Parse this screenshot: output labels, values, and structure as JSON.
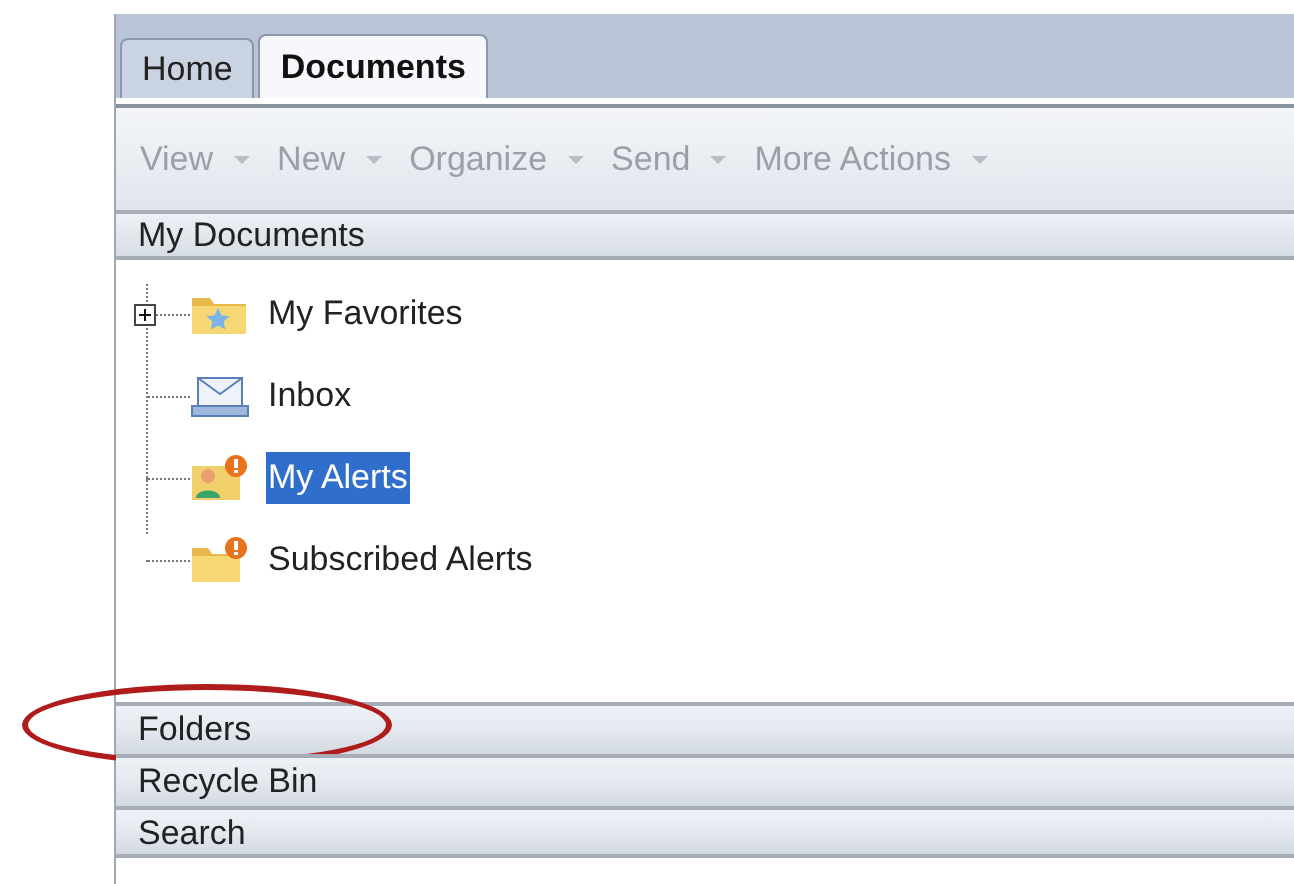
{
  "tabs": [
    {
      "label": "Home",
      "selected": false
    },
    {
      "label": "Documents",
      "selected": true
    }
  ],
  "toolbar": [
    {
      "label": "View"
    },
    {
      "label": "New"
    },
    {
      "label": "Organize"
    },
    {
      "label": "Send"
    },
    {
      "label": "More Actions"
    }
  ],
  "panel": {
    "title": "My Documents"
  },
  "tree": [
    {
      "label": "My Favorites",
      "kind": "favorites",
      "expandable": true,
      "selected": false
    },
    {
      "label": "Inbox",
      "kind": "inbox",
      "expandable": false,
      "selected": false
    },
    {
      "label": "My Alerts",
      "kind": "alerts",
      "expandable": false,
      "selected": true
    },
    {
      "label": "Subscribed Alerts",
      "kind": "subscribed",
      "expandable": false,
      "selected": false
    }
  ],
  "sections": [
    {
      "label": "Folders",
      "circled": true
    },
    {
      "label": "Recycle Bin",
      "circled": false
    },
    {
      "label": "Search",
      "circled": false
    }
  ]
}
